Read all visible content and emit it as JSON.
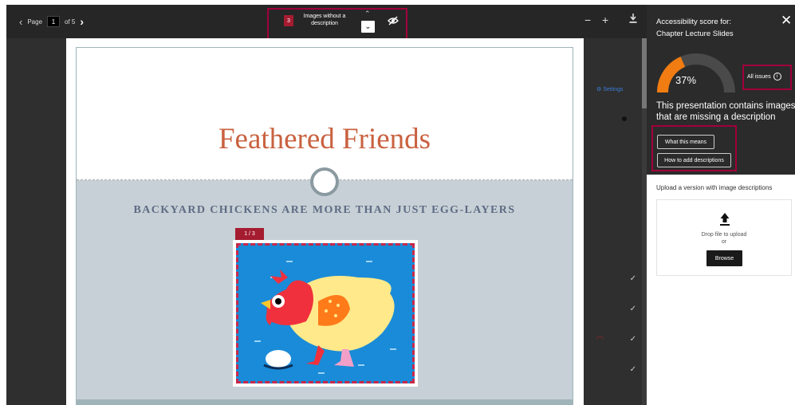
{
  "toolbar": {
    "page_label": "Page",
    "page_number": "1",
    "page_total": "of 5",
    "issue_count": "3",
    "issue_label": "Images without a description",
    "zoom_out": "−",
    "zoom_in": "+"
  },
  "slide": {
    "title": "Feathered Friends",
    "subtitle": "BACKYARD CHICKENS ARE MORE THAN JUST EGG-LAYERS",
    "image_tag": "1 / 3"
  },
  "sidebar_peek": {
    "settings_label": "Settings"
  },
  "panel": {
    "heading": "Accessibility score for:",
    "document_name": "Chapter Lecture Slides",
    "score_percent": 37,
    "score_text": "37%",
    "all_issues_label": "All issues",
    "message": "This presentation contains images that are missing a description",
    "what_this_means_label": "What this means",
    "how_to_add_label": "How to add descriptions",
    "upload_label": "Upload a version with image descriptions",
    "drop_text": "Drop file to upload",
    "or_text": "or",
    "browse_label": "Browse"
  },
  "colors": {
    "accent_red": "#a51c30",
    "highlight_border": "#a1003b",
    "gauge_orange": "#f07c12",
    "title_orange": "#c9613f"
  }
}
